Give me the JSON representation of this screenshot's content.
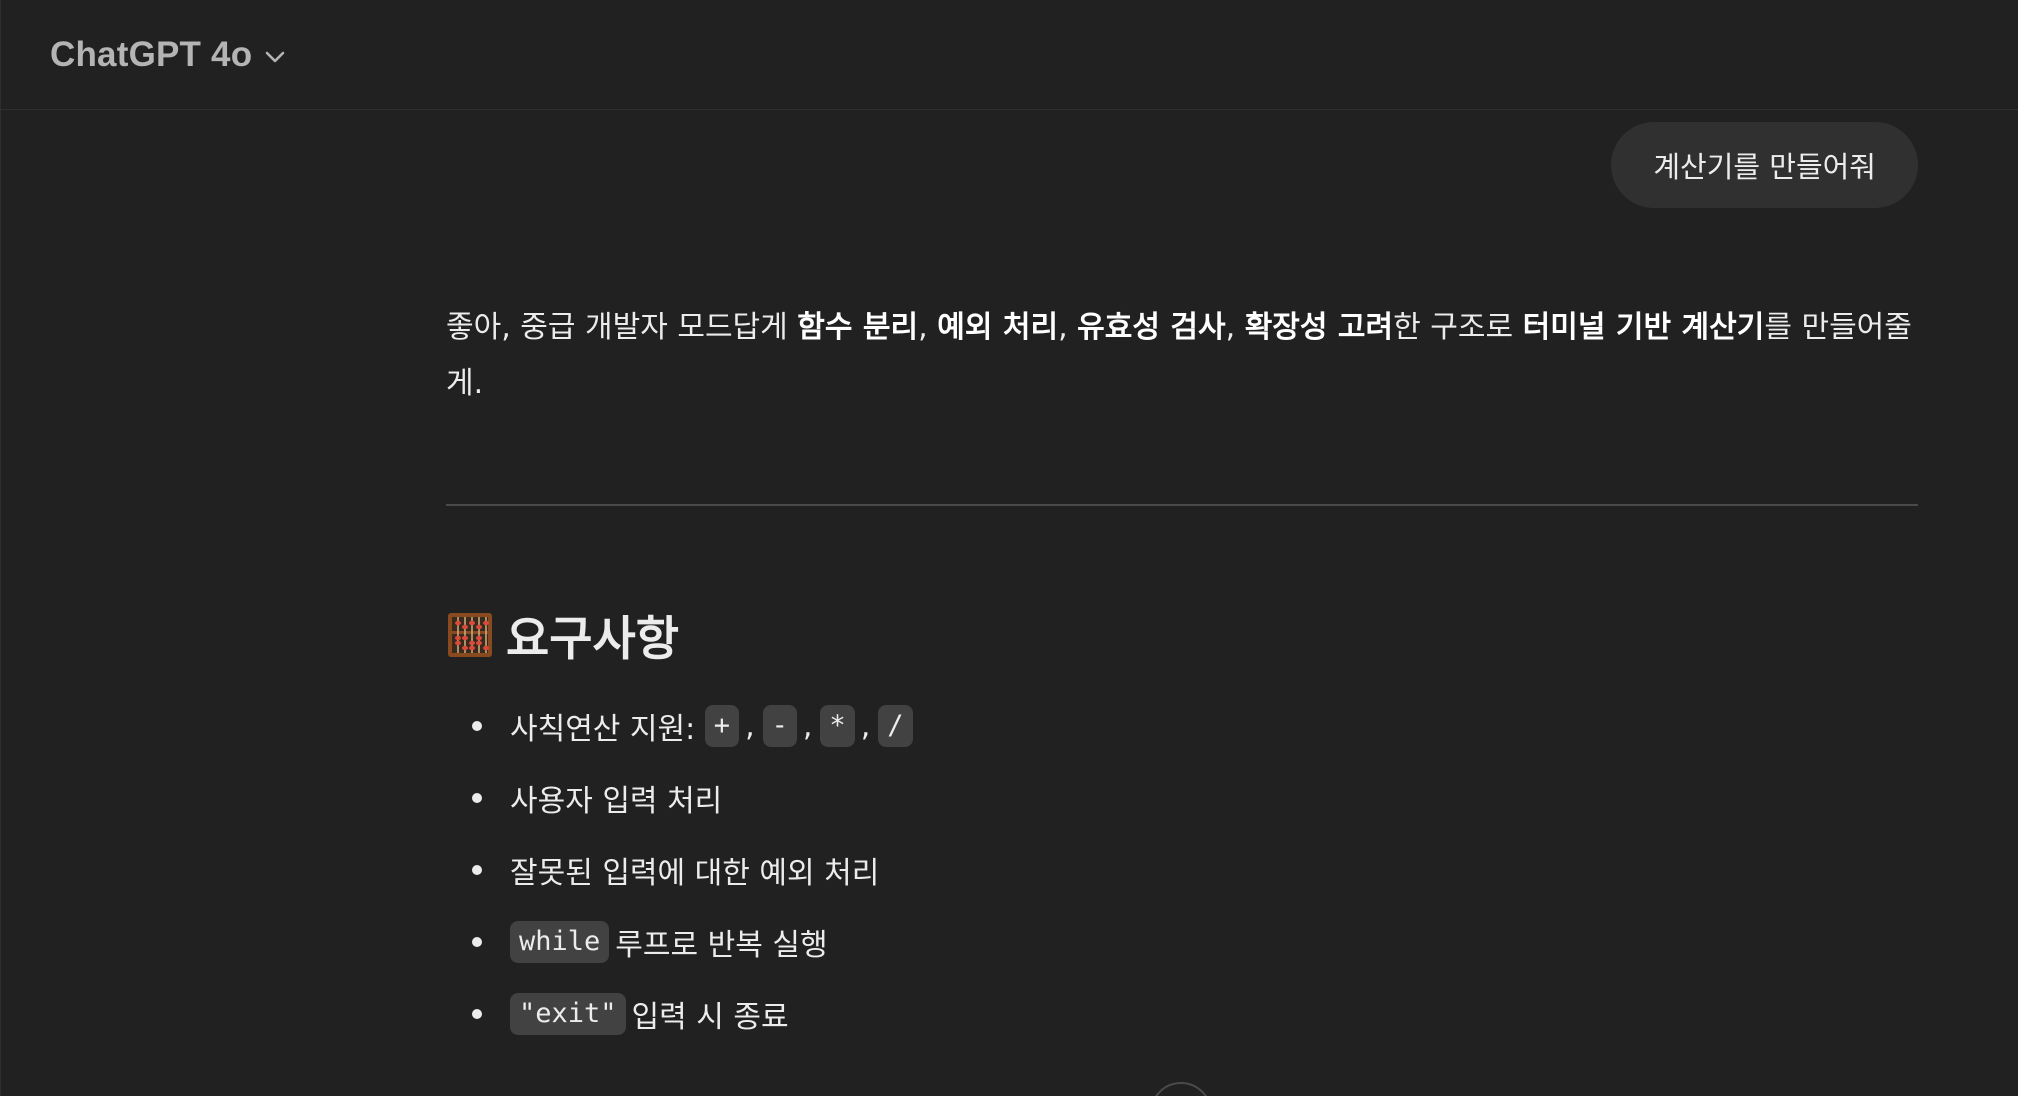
{
  "header": {
    "model_name": "ChatGPT 4o",
    "model_icon": "chevron-down-icon"
  },
  "user_message": {
    "text": "계산기를 만들어줘"
  },
  "assistant": {
    "intro": {
      "p1": "좋아, 중급 개발자 모드답게 ",
      "b1": "함수 분리",
      "p2": ", ",
      "b2": "예외 처리",
      "p3": ", ",
      "b3": "유효성 검사",
      "p4": ", ",
      "b4": "확장성 고려",
      "p5": "한 구조로 ",
      "b5": "터미널 기반 계산기",
      "p6": "를 만들어줄게."
    },
    "section_heading": "요구사항",
    "section_icon": "abacus-icon",
    "requirements": {
      "item1_text": "사칙연산 지원:",
      "item1_ops": [
        "+",
        "-",
        "*",
        "/"
      ],
      "item1_sep": ",",
      "item2_text": "사용자 입력 처리",
      "item3_text": "잘못된 입력에 대한 예외 처리",
      "item4_code": "while",
      "item4_text": "루프로 반복 실행",
      "item5_code": "\"exit\"",
      "item5_text": "입력 시 종료"
    }
  },
  "colors": {
    "background": "#212121",
    "bubble": "#303030",
    "text": "#ececec",
    "code_bg": "#424242",
    "muted": "#b4b4b4"
  }
}
